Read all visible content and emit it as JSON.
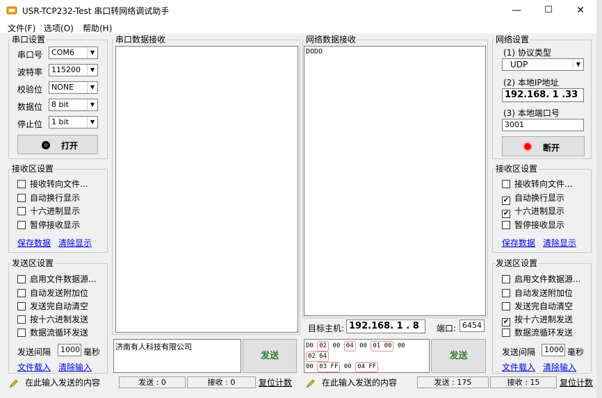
{
  "window": {
    "title": "USR-TCP232-Test 串口转网络调试助手",
    "minimize": "—",
    "maximize": "☐",
    "close": "✕"
  },
  "menu": [
    "文件(F)",
    "选项(O)",
    "帮助(H)"
  ],
  "serial": {
    "title": "串口设置",
    "port_label": "串口号",
    "port_value": "COM6",
    "baud_label": "波特率",
    "baud_value": "115200",
    "parity_label": "校验位",
    "parity_value": "NONE",
    "databits_label": "数据位",
    "databits_value": "8 bit",
    "stopbits_label": "停止位",
    "stopbits_value": "1 bit",
    "open_button": "打开"
  },
  "left_receive": {
    "title": "接收区设置",
    "options": [
      {
        "label": "接收转向文件...",
        "checked": false
      },
      {
        "label": "自动换行显示",
        "checked": false
      },
      {
        "label": "十六进制显示",
        "checked": false
      },
      {
        "label": "暂停接收显示",
        "checked": false
      }
    ],
    "save_link": "保存数据",
    "clear_link": "清除显示"
  },
  "left_send": {
    "title": "发送区设置",
    "options": [
      {
        "label": "启用文件数据源...",
        "checked": false
      },
      {
        "label": "自动发送附加位",
        "checked": false
      },
      {
        "label": "发送完自动清空",
        "checked": false
      },
      {
        "label": "按十六进制发送",
        "checked": false
      },
      {
        "label": "数据流循环发送",
        "checked": false
      }
    ],
    "interval_label": "发送间隔",
    "interval_value": "1000",
    "interval_unit": "毫秒",
    "load_link": "文件载入",
    "clear_link": "清除输入"
  },
  "serial_receive": {
    "title": "串口数据接收",
    "content": ""
  },
  "serial_send": {
    "content": "济南有人科技有限公司",
    "send_button": "发送"
  },
  "net_receive": {
    "title": "网络数据接收",
    "content": "DODO"
  },
  "net_target": {
    "host_label": "目标主机:",
    "host_value": "192.168. 1 . 8",
    "port_label": "端口:",
    "port_value": "6454"
  },
  "net_send": {
    "line1": [
      "D0",
      "02",
      "00",
      "04",
      "00",
      "01",
      "00",
      "00",
      "02",
      "64"
    ],
    "line2": [
      "00",
      "03",
      "FF",
      "00",
      "04",
      "FF"
    ],
    "send_button": "发送"
  },
  "network": {
    "title": "网络设置",
    "protocol_label": "(1) 协议类型",
    "protocol_value": "UDP",
    "ip_label": "(2) 本地IP地址",
    "ip_value": "192.168. 1 .33",
    "port_label": "(3) 本地端口号",
    "port_value": "3001",
    "disconnect_button": "断开"
  },
  "right_receive": {
    "title": "接收区设置",
    "options": [
      {
        "label": "接收转向文件...",
        "checked": false
      },
      {
        "label": "自动换行显示",
        "checked": true
      },
      {
        "label": "十六进制显示",
        "checked": true
      },
      {
        "label": "暂停接收显示",
        "checked": false
      }
    ],
    "save_link": "保存数据",
    "clear_link": "清除显示"
  },
  "right_send": {
    "title": "发送区设置",
    "options": [
      {
        "label": "启用文件数据源...",
        "checked": false
      },
      {
        "label": "自动发送附加位",
        "checked": false
      },
      {
        "label": "发送完自动清空",
        "checked": false
      },
      {
        "label": "按十六进制发送",
        "checked": true
      },
      {
        "label": "数据流循环发送",
        "checked": false
      }
    ],
    "interval_label": "发送间隔",
    "interval_value": "1000",
    "interval_unit": "毫秒",
    "load_link": "文件载入",
    "clear_link": "清除输入"
  },
  "statusbar": {
    "left_hint": "在此输入发送的内容",
    "left_send": "发送 : 0",
    "left_recv": "接收 : 0",
    "left_reset": "复位计数",
    "right_hint": "在此输入发送的内容",
    "right_send": "发送 : 175",
    "right_recv": "接收 : 15",
    "right_reset": "复位计数"
  },
  "colors": {
    "window_bg": "#f0f0f0",
    "send_button_text": "#2e7d32",
    "link": "#0000ee",
    "led_red": "#ff0000",
    "hex_highlight": "#e88888"
  },
  "icons": [
    "app-icon",
    "radio-button-icon",
    "red-led-icon",
    "pencil-hint-icon"
  ]
}
